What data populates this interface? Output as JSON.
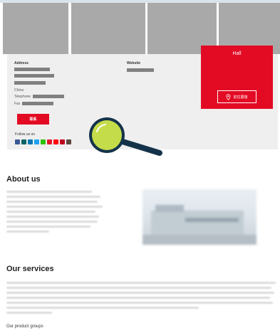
{
  "gallery": {
    "tiles": 4
  },
  "contact": {
    "address_label": "Address",
    "website_label": "Website",
    "country": "China",
    "telephone_label": "Telephone",
    "fax_label": "Fax",
    "contact_button": "联系"
  },
  "hall": {
    "title": "Hall",
    "button_label": "前往展馆"
  },
  "social": {
    "follow_label": "Follow us on",
    "icons": [
      {
        "name": "facebook-icon",
        "color": "#3b5998"
      },
      {
        "name": "xing-icon",
        "color": "#026466"
      },
      {
        "name": "linkedin-icon",
        "color": "#0077b5"
      },
      {
        "name": "twitter-icon",
        "color": "#1da1f2"
      },
      {
        "name": "wechat-icon",
        "color": "#2dc100"
      },
      {
        "name": "weibo-icon",
        "color": "#e6162d"
      },
      {
        "name": "youtube-icon",
        "color": "#ff0000"
      },
      {
        "name": "pinterest-icon",
        "color": "#bd081c"
      },
      {
        "name": "instagram-icon",
        "color": "#5b4a3f"
      }
    ]
  },
  "about": {
    "heading": "About us"
  },
  "services": {
    "heading": "Our services"
  },
  "product_groups_label": "Our product groups",
  "colors": {
    "accent": "#e30b24",
    "magnifier_fill": "#c5dc4a",
    "magnifier_ring": "#14334a"
  }
}
